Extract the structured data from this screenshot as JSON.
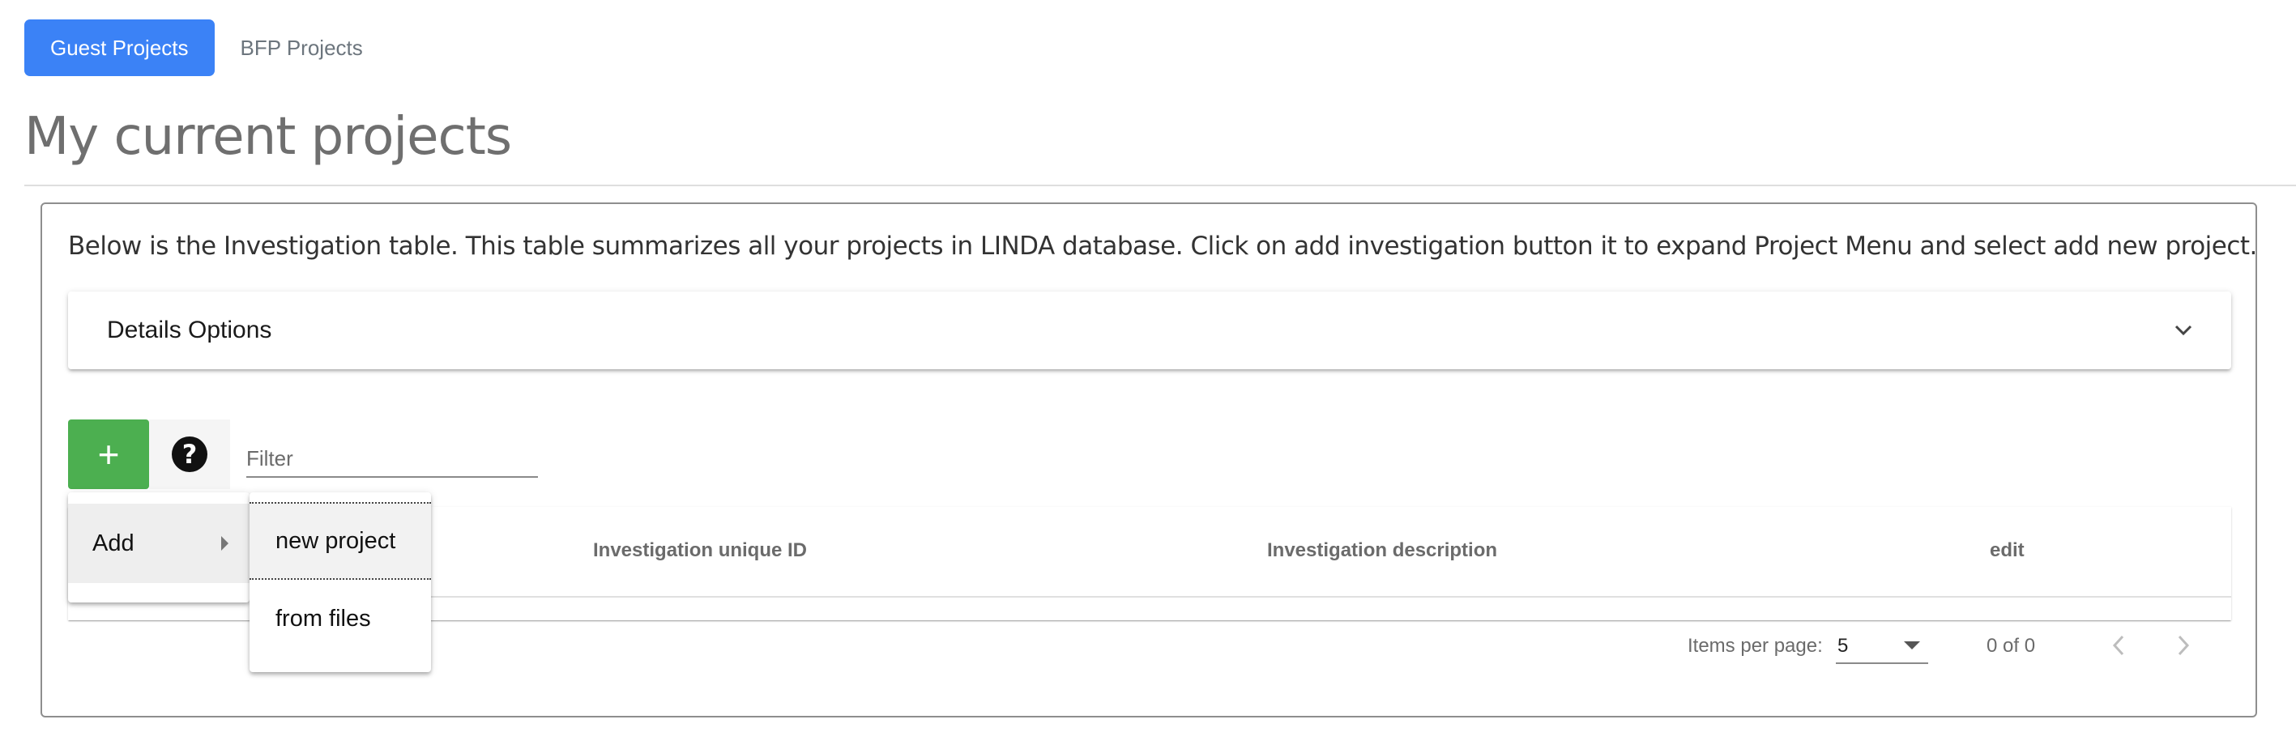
{
  "tabs": [
    {
      "label": "Guest Projects",
      "active": true
    },
    {
      "label": "BFP Projects",
      "active": false
    }
  ],
  "page": {
    "title": "My current projects",
    "intro": "Below is the Investigation table. This table summarizes all your projects in LINDA database. Click on add investigation button it to expand Project Menu and select add new project."
  },
  "details": {
    "title": "Details Options",
    "icon": "chevron-down-icon"
  },
  "toolbar": {
    "add_icon": "+",
    "help_icon": "?",
    "filter_placeholder": "Filter"
  },
  "table": {
    "columns": [
      "Investigation unique ID",
      "Investigation description",
      "edit"
    ],
    "rows": []
  },
  "paginator": {
    "items_per_page_label": "Items per page:",
    "items_per_page_value": "5",
    "range": "0 of 0"
  },
  "add_menu": {
    "item_label": "Add",
    "submenu": [
      "new project",
      "from files"
    ]
  },
  "colors": {
    "primary": "#3b82f6",
    "add_button": "#4caf50",
    "muted_text": "#6b6b6b"
  }
}
